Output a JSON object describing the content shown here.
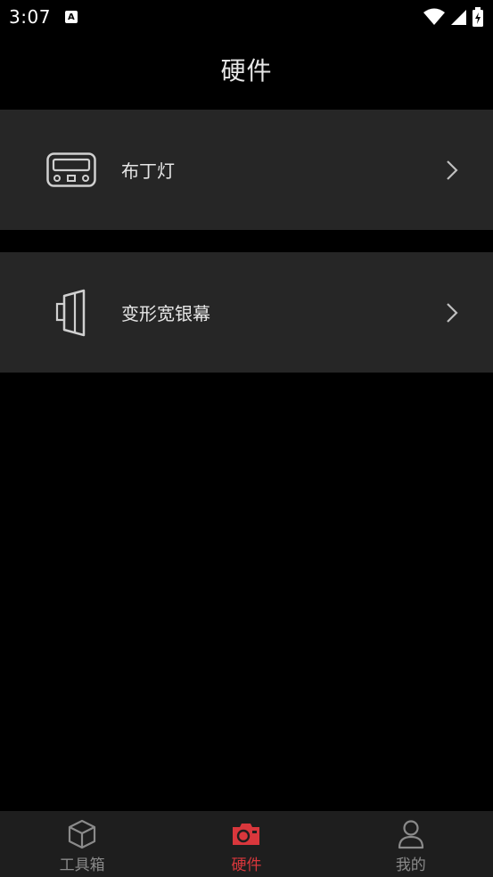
{
  "status_bar": {
    "time": "3:07",
    "app_icon_letter": "A",
    "icons": [
      "wifi-icon",
      "signal-icon",
      "battery-charging-icon"
    ]
  },
  "header": {
    "title": "硬件"
  },
  "devices": [
    {
      "label": "布丁灯",
      "icon": "pudding-lamp-icon"
    },
    {
      "label": "变形宽银幕",
      "icon": "anamorphic-lens-icon"
    }
  ],
  "tab_bar": {
    "tabs": [
      {
        "label": "工具箱",
        "icon": "cube-icon",
        "active": false
      },
      {
        "label": "硬件",
        "icon": "camera-icon",
        "active": true
      },
      {
        "label": "我的",
        "icon": "person-icon",
        "active": false
      }
    ]
  },
  "colors": {
    "background": "#000000",
    "row_background": "#262626",
    "tab_bar_background": "#1e1e1e",
    "accent": "#d9373c",
    "inactive": "#8a8a8a"
  }
}
